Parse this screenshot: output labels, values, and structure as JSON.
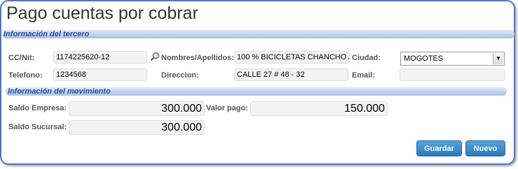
{
  "window": {
    "title": "Pago cuentas por cobrar"
  },
  "tercero": {
    "section_title": "Información del tercero",
    "ccnit_label": "CC/Nit:",
    "ccnit_value": "1174225620-12",
    "nombres_label": "Nombres/Apellidos:",
    "nombres_value": "100 % BICICLETAS CHANCHO A",
    "ciudad_label": "Ciudad:",
    "ciudad_value": "MOGOTES",
    "telefono_label": "Telefono:",
    "telefono_value": "1234568",
    "direccion_label": "Direccion:",
    "direccion_value": "CALLE 27 # 48 - 32",
    "email_label": "Email:",
    "email_value": ""
  },
  "movimiento": {
    "section_title": "Información del movimiento",
    "saldo_empresa_label": "Saldo Empresa:",
    "saldo_empresa_value": "300.000",
    "valor_pago_label": "Valor pago:",
    "valor_pago_value": "150.000",
    "saldo_sucursal_label": "Saldo Sucursal:",
    "saldo_sucursal_value": "300.000"
  },
  "buttons": {
    "guardar": "Guardar",
    "nuevo": "Nuevo"
  },
  "icons": {
    "search": "magnifier-icon",
    "dropdown": "chevron-down-icon"
  },
  "colors": {
    "accent": "#2b7bbd",
    "section_text": "#1f4f96",
    "border": "#4a78c8"
  }
}
